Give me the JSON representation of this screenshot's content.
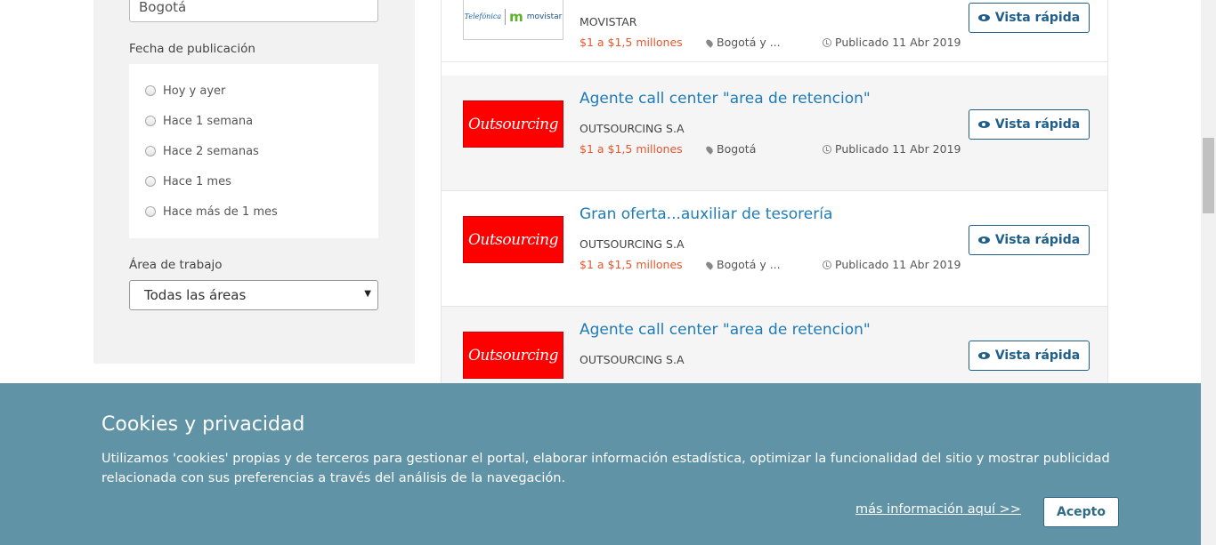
{
  "sidebar": {
    "location_value": "Bogotá",
    "date_filter": {
      "title": "Fecha de publicación",
      "options": [
        "Hoy y ayer",
        "Hace 1 semana",
        "Hace 2 semanas",
        "Hace 1 mes",
        "Hace más de 1 mes"
      ]
    },
    "area_filter": {
      "title": "Área de trabajo",
      "selected": "Todas las áreas"
    }
  },
  "offers": [
    {
      "title": "",
      "company": "MOVISTAR",
      "logo": {
        "type": "movistar",
        "left_text": "Telefónica",
        "right_text": "movistar"
      },
      "salary": "$1 a $1,5 millones",
      "location": "Bogotá y ...",
      "published": "Publicado 11 Abr 2019",
      "button": "Vista rápida"
    },
    {
      "title": "Agente call center \"area de retencion\"",
      "company": "OUTSOURCING S.A",
      "logo": {
        "type": "outsourcing",
        "text": "Outsourcing"
      },
      "salary": "$1 a $1,5 millones",
      "location": "Bogotá",
      "published": "Publicado 11 Abr 2019",
      "button": "Vista rápida"
    },
    {
      "title": "Gran oferta...auxiliar de tesorería",
      "company": "OUTSOURCING S.A",
      "logo": {
        "type": "outsourcing",
        "text": "Outsourcing"
      },
      "salary": "$1 a $1,5 millones",
      "location": "Bogotá y ...",
      "published": "Publicado 11 Abr 2019",
      "button": "Vista rápida"
    },
    {
      "title": "Agente call center \"area de retencion\"",
      "company": "OUTSOURCING S.A",
      "logo": {
        "type": "outsourcing",
        "text": "Outsourcing"
      },
      "salary": "",
      "location": "",
      "published": "",
      "button": "Vista rápida"
    }
  ],
  "cookie_banner": {
    "title": "Cookies y privacidad",
    "text": "Utilizamos 'cookies' propias y de terceros para gestionar el portal, elaborar información estadística, optimizar la funcionalidad del sitio y mostrar publicidad relacionada con sus preferencias a través del análisis de la navegación.",
    "more_info_link": "más información aquí >>",
    "accept_button": "Acepto"
  },
  "colors": {
    "link_blue": "#1f7bb6",
    "salary_orange": "#e4572e",
    "banner_bg": "#5f93a5",
    "logo_red": "#ff0000"
  }
}
